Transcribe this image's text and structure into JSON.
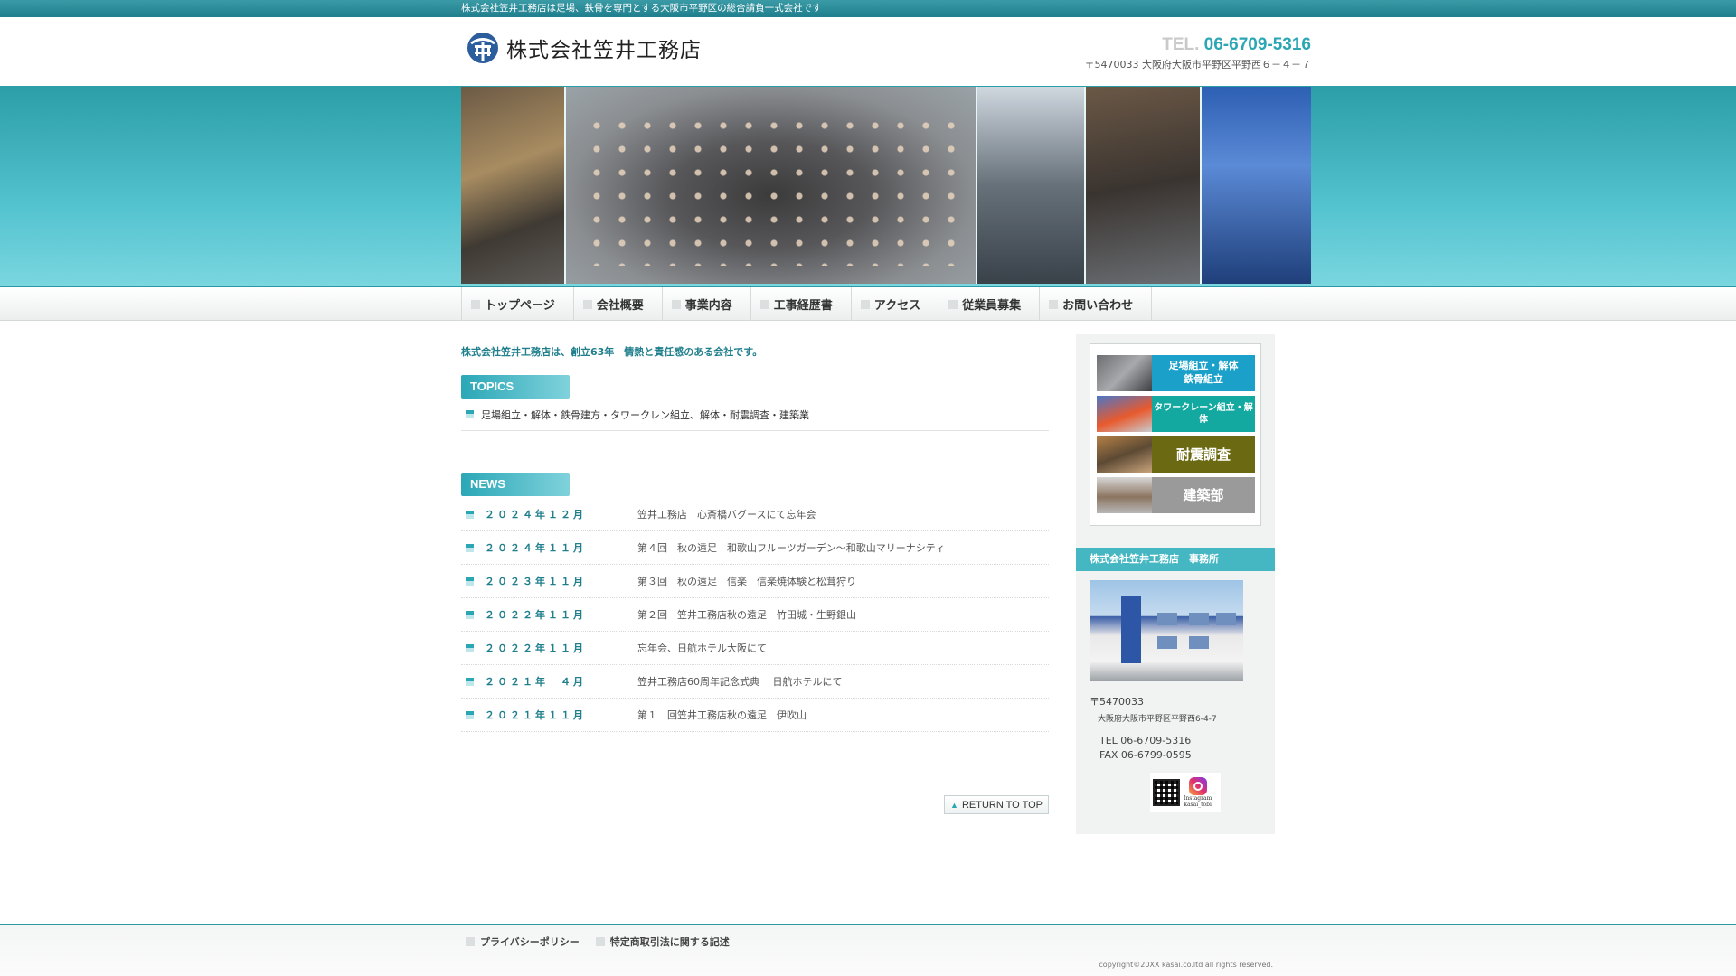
{
  "topbar": {
    "text": "株式会社笠井工務店は足場、鉄骨を専門とする大阪市平野区の総合請負一式会社です"
  },
  "header": {
    "company_name": "株式会社笠井工務店",
    "tel_label": "TEL.",
    "tel_number": "06-6709-5316",
    "address": "〒5470033 大阪府大阪市平野区平野西６－４－７"
  },
  "nav": {
    "items": [
      {
        "label": "トップページ"
      },
      {
        "label": "会社概要"
      },
      {
        "label": "事業内容"
      },
      {
        "label": "工事経歴書"
      },
      {
        "label": "アクセス"
      },
      {
        "label": "従業員募集"
      },
      {
        "label": "お問い合わせ"
      }
    ]
  },
  "main": {
    "tagline": "株式会社笠井工務店は、創立63年　情熱と責任感のある会社です。",
    "topics_heading": "TOPICS",
    "topics_text": "足場組立・解体・鉄骨建方・タワークレン組立、解体・耐震調査・建築業",
    "news_heading": "NEWS",
    "news": [
      {
        "date": "２０２４年１２月",
        "text": "笠井工務店　心斎橋バグースにて忘年会"
      },
      {
        "date": "２０２４年１１月",
        "text": "第４回　秋の遠足　和歌山フルーツガーデン～和歌山マリーナシティ"
      },
      {
        "date": "２０２３年１１月",
        "text": "第３回　秋の遠足　信楽　信楽焼体験と松茸狩り"
      },
      {
        "date": "２０２２年１１月",
        "text": "第２回　笠井工務店秋の遠足　竹田城・生野銀山"
      },
      {
        "date": "２０２２年１１月",
        "text": "忘年会、日航ホテル大阪にて"
      },
      {
        "date": "２０２１年　４月",
        "text": "笠井工務店60周年記念式典　 日航ホテルにて"
      },
      {
        "date": "２０２１年１１月",
        "text": "第１　回笠井工務店秋の遠足　伊吹山"
      }
    ],
    "return_label": "RETURN TO TOP"
  },
  "sidebar": {
    "banners": [
      {
        "line1": "足場組立・解体",
        "line2": "鉄骨組立"
      },
      {
        "line1": "タワークレーン組立・解体",
        "line2": ""
      },
      {
        "line1": "耐震調査",
        "line2": ""
      },
      {
        "line1": "建築部",
        "line2": ""
      }
    ],
    "office_heading": "株式会社笠井工務店　事務所",
    "postal": "〒5470033",
    "address": "大阪府大阪市平野区平野西6-4-7",
    "tel": "TEL 06-6709-5316",
    "fax": "FAX 06-6799-0595",
    "instagram_handle": "kasai_tobi",
    "instagram_caption": "Instagram"
  },
  "footer": {
    "links": [
      {
        "label": "プライバシーポリシー"
      },
      {
        "label": "特定商取引法に関する記述"
      }
    ],
    "copyright": "copyright©20XX kasai.co.ltd all rights reserved."
  }
}
